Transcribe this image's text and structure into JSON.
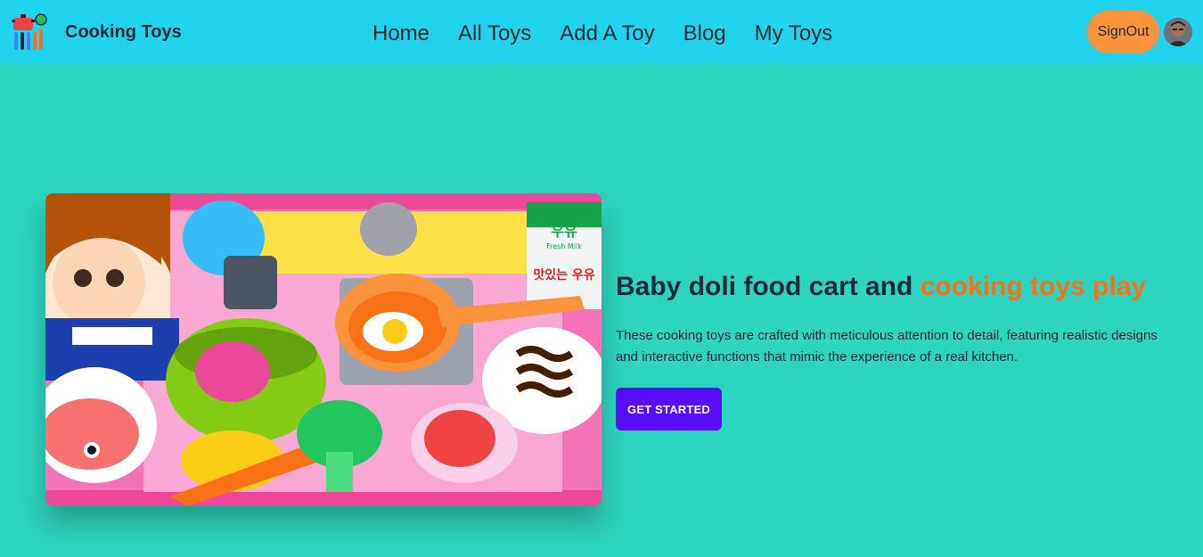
{
  "navbar": {
    "brand": "Cooking Toys",
    "links": [
      "Home",
      "All Toys",
      "Add A Toy",
      "Blog",
      "My Toys"
    ],
    "signout_label": "SignOut"
  },
  "hero": {
    "title_main": "Baby doli food cart and ",
    "title_accent": "cooking toys play",
    "description": "These cooking toys are crafted with meticulous attention to detail, featuring realistic designs and interactive functions that mimic the experience of a real kitchen.",
    "cta_label": "GET STARTED",
    "milk_label_1": "우유",
    "milk_label_2": "Fresh Milk",
    "milk_label_3": "맛있는 우유"
  },
  "colors": {
    "navbar_bg": "#22d3ee",
    "page_bg": "#2dd4bf",
    "accent_orange": "#f97316",
    "cta_bg": "#570df8",
    "signout_bg": "#fb923c"
  }
}
